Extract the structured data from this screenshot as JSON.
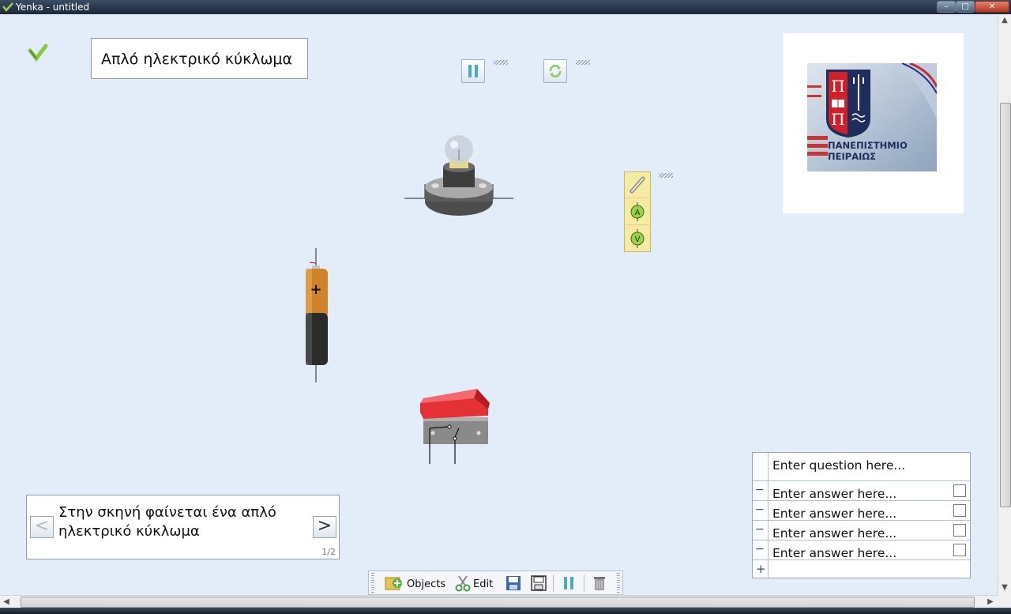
{
  "window": {
    "title": "Yenka - untitled",
    "controls": {
      "minimize": "–",
      "maximize": "□",
      "close": "✕"
    }
  },
  "scene_title": "Απλό ηλεκτρικό κύκλωμα",
  "playback": {
    "pause_icon": "pause-icon",
    "reset_icon": "refresh-icon"
  },
  "meters_palette": [
    {
      "name": "wire",
      "label": ""
    },
    {
      "name": "ammeter",
      "label": "A"
    },
    {
      "name": "voltmeter",
      "label": "V"
    }
  ],
  "logo": {
    "line1": "ΠΑΝΕΠΙΣΤΗΜΙΟ",
    "line2": "ΠΕΙΡΑΙΩΣ"
  },
  "battery": {
    "plus_label": "+"
  },
  "caption": {
    "text": "Στην σκηνή φαίνεται ένα απλό ηλεκτρικό κύκλωμα",
    "page": "1/2",
    "prev": "<",
    "next": ">"
  },
  "quiz": {
    "question_placeholder": "Enter question here...",
    "answers": [
      "Enter answer here...",
      "Enter answer here...",
      "Enter answer here...",
      "Enter answer here..."
    ],
    "add_symbol": "+",
    "remove_symbol": "−"
  },
  "toolbar": {
    "objects_label": "Objects",
    "edit_label": "Edit"
  },
  "colors": {
    "canvas_bg": "#e3edfa",
    "switch_red": "#e53036",
    "battery_copper": "#c77a26",
    "meter_palette": "#f7eba3"
  }
}
